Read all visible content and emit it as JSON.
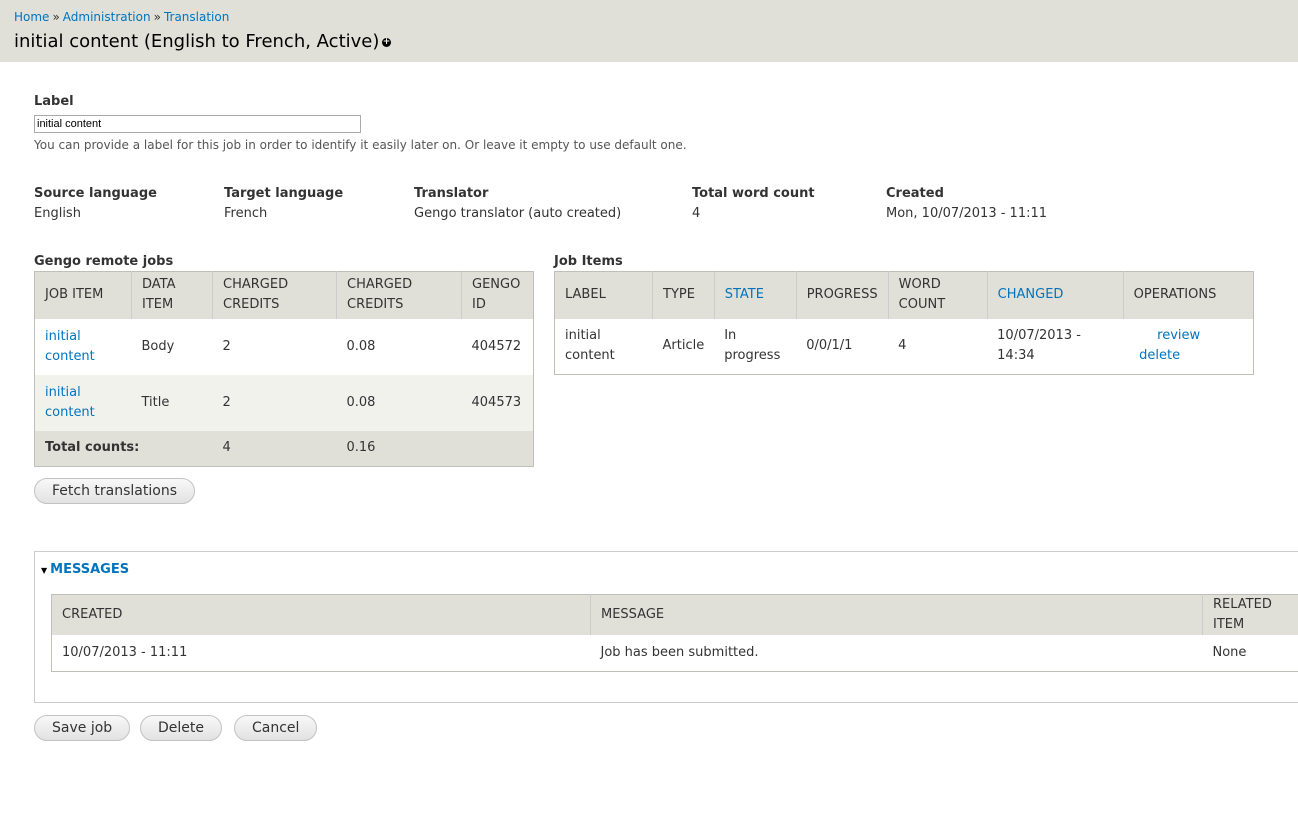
{
  "breadcrumb": {
    "items": [
      "Home",
      "Administration",
      "Translation"
    ],
    "separator": "»"
  },
  "page": {
    "title": "initial content (English to French, Active)"
  },
  "label_field": {
    "label": "Label",
    "value": "initial content",
    "description": "You can provide a label for this job in order to identify it easily later on. Or leave it empty to use default one."
  },
  "info": [
    {
      "heading": "Source language",
      "value": "English"
    },
    {
      "heading": "Target language",
      "value": "French"
    },
    {
      "heading": "Translator",
      "value": "Gengo translator (auto created)"
    },
    {
      "heading": "Total word count",
      "value": "4"
    },
    {
      "heading": "Created",
      "value": "Mon, 10/07/2013 - 11:11"
    }
  ],
  "gengo": {
    "title": "Gengo remote jobs",
    "headers": [
      "JOB ITEM",
      "DATA ITEM",
      "CHARGED CREDITS",
      "CHARGED CREDITS",
      "GENGO ID"
    ],
    "rows": [
      {
        "job_item": "initial content",
        "data_item": "Body",
        "credits": "2",
        "amount": "0.08",
        "gengo_id": "404572"
      },
      {
        "job_item": "initial content",
        "data_item": "Title",
        "credits": "2",
        "amount": "0.08",
        "gengo_id": "404573"
      }
    ],
    "total": {
      "label": "Total counts:",
      "credits": "4",
      "amount": "0.16"
    }
  },
  "job_items": {
    "title": "Job Items",
    "headers": [
      "LABEL",
      "TYPE",
      "STATE",
      "PROGRESS",
      "WORD COUNT",
      "CHANGED",
      "OPERATIONS"
    ],
    "rows": [
      {
        "label": "initial content",
        "type": "Article",
        "state": "In progress",
        "progress": "0/0/1/1",
        "word_count": "4",
        "changed": "10/07/2013 - 14:34",
        "op_review": "review",
        "op_delete": "delete"
      }
    ]
  },
  "fetch_button": "Fetch translations",
  "messages": {
    "title": "MESSAGES",
    "headers": [
      "CREATED",
      "MESSAGE",
      "RELATED ITEM"
    ],
    "rows": [
      {
        "created": "10/07/2013 - 11:11",
        "message": "Job has been submitted.",
        "related": "None"
      }
    ]
  },
  "actions": {
    "save": "Save job",
    "delete": "Delete",
    "cancel": "Cancel"
  }
}
